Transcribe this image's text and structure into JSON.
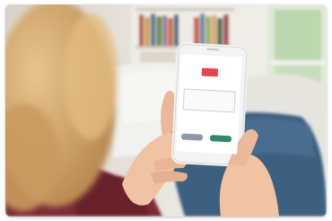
{
  "photo": {
    "subject": "",
    "colors": {
      "wall": "#ece9e3",
      "bookshelf": "#8a6a48",
      "window": "#cfe3c6",
      "sofa": "#f1f1ef",
      "jeans": "#3e5f80",
      "sweater": "#7e2a34",
      "hair": "#d6a86c",
      "skin": "#efc3a3",
      "phone_body": "#f4f4f4",
      "screen": "#ffffff",
      "accent": "#e2474c",
      "confirm": "#2f8a6a",
      "decline": "#8f9aa6"
    }
  },
  "phone": {
    "prompt": "",
    "card_label": "",
    "card_value": "",
    "left_button": "",
    "right_button": ""
  }
}
